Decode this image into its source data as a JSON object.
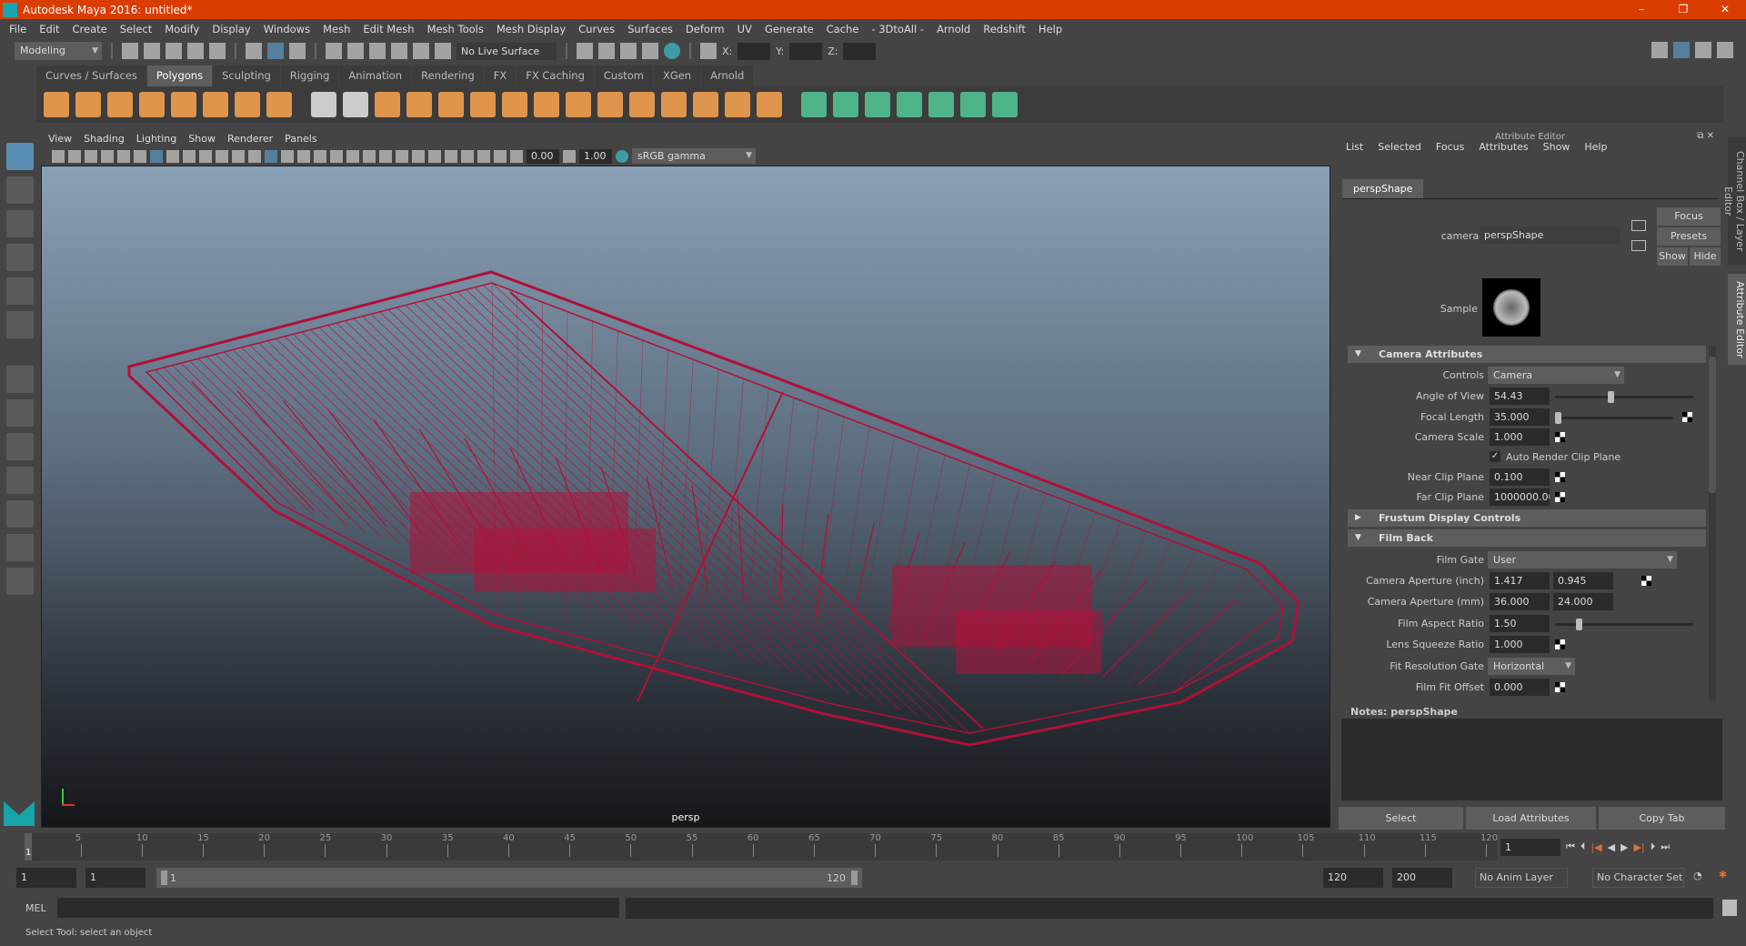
{
  "window": {
    "title": "Autodesk Maya 2016: untitled*",
    "controls": [
      "–",
      "❐",
      "✕"
    ]
  },
  "menu": [
    "File",
    "Edit",
    "Create",
    "Select",
    "Modify",
    "Display",
    "Windows",
    "Mesh",
    "Edit Mesh",
    "Mesh Tools",
    "Mesh Display",
    "Curves",
    "Surfaces",
    "Deform",
    "UV",
    "Generate",
    "Cache",
    "- 3DtoAll -",
    "Arnold",
    "Redshift",
    "Help"
  ],
  "status": {
    "mode": "Modeling",
    "live_surface": "No Live Surface",
    "x_label": "X:",
    "y_label": "Y:",
    "z_label": "Z:",
    "x": "",
    "y": "",
    "z": ""
  },
  "shelf": {
    "tabs": [
      "Curves / Surfaces",
      "Polygons",
      "Sculpting",
      "Rigging",
      "Animation",
      "Rendering",
      "FX",
      "FX Caching",
      "Custom",
      "XGen",
      "Arnold"
    ],
    "active": "Polygons",
    "icons": [
      "poly-sphere",
      "poly-cube",
      "poly-cylinder",
      "poly-cone",
      "poly-plane",
      "poly-torus",
      "poly-pyramid",
      "poly-pipe",
      "combine",
      "separate",
      "mirror",
      "smooth",
      "bevel",
      "bridge",
      "extrude",
      "append",
      "bevel-edge",
      "multi-cut",
      "target-weld",
      "connect",
      "insert-edge-loop",
      "offset-edge-loop",
      "mesh-split",
      "uv-planar",
      "uv-cylindrical",
      "uv-spherical",
      "uv-auto",
      "uv-editor",
      "uv-layout",
      "uv-unfold"
    ],
    "icon_colors": {
      "poly": "#e0954c",
      "uv": "#4fb38a"
    }
  },
  "panel": {
    "menu": [
      "View",
      "Shading",
      "Lighting",
      "Show",
      "Renderer",
      "Panels"
    ],
    "near": "0.00",
    "exposure": "1.00",
    "color_space": "sRGB gamma",
    "camera_label": "persp",
    "wire_color": "#b0103a"
  },
  "attr": {
    "title": "Attribute Editor",
    "menu": [
      "List",
      "Selected",
      "Focus",
      "Attributes",
      "Show",
      "Help"
    ],
    "tab": "perspShape",
    "camera_label": "camera:",
    "camera_value": "perspShape",
    "buttons": {
      "focus": "Focus",
      "presets": "Presets",
      "show": "Show",
      "hide": "Hide"
    },
    "sample_label": "Sample",
    "camera_attributes": {
      "title": "Camera Attributes",
      "controls_label": "Controls",
      "controls": "Camera",
      "angle_label": "Angle of View",
      "angle": "54.43",
      "angle_slider": 0.4,
      "focal_label": "Focal Length",
      "focal": "35.000",
      "focal_slider": 0.02,
      "scale_label": "Camera Scale",
      "scale": "1.000",
      "auto_clip_label": "Auto Render Clip Plane",
      "auto_clip": true,
      "near_label": "Near Clip Plane",
      "near": "0.100",
      "far_label": "Far Clip Plane",
      "far": "1000000.000"
    },
    "frustum": {
      "title": "Frustum Display Controls"
    },
    "film_back": {
      "title": "Film Back",
      "gate_label": "Film Gate",
      "gate": "User",
      "ap_inch_label": "Camera Aperture (inch)",
      "ap_inch": [
        "1.417",
        "0.945"
      ],
      "ap_mm_label": "Camera Aperture (mm)",
      "ap_mm": [
        "36.000",
        "24.000"
      ],
      "aspect_label": "Film Aspect Ratio",
      "aspect": "1.50",
      "aspect_slider": 0.17,
      "squeeze_label": "Lens Squeeze Ratio",
      "squeeze": "1.000",
      "fit_label": "Fit Resolution Gate",
      "fit": "Horizontal",
      "offset_label": "Film Fit Offset",
      "offset": "0.000"
    },
    "notes_label": "Notes:  perspShape",
    "bottom": [
      "Select",
      "Load Attributes",
      "Copy Tab"
    ]
  },
  "side_tabs": [
    "Channel Box / Layer Editor",
    "Attribute Editor"
  ],
  "timeline": {
    "ticks": [
      "5",
      "10",
      "15",
      "20",
      "25",
      "30",
      "35",
      "40",
      "45",
      "50",
      "55",
      "60",
      "65",
      "70",
      "75",
      "80",
      "85",
      "90",
      "95",
      "100",
      "105",
      "110",
      "115",
      "120"
    ],
    "current": "1",
    "current_field": "1"
  },
  "range": {
    "start": "1",
    "anim_start": "1",
    "slider_start": "1",
    "slider_end": "120",
    "end": "120",
    "anim_end": "200",
    "anim_layer": "No Anim Layer",
    "character_set": "No Character Set"
  },
  "mel": {
    "label": "MEL"
  },
  "help": "Select Tool: select an object"
}
